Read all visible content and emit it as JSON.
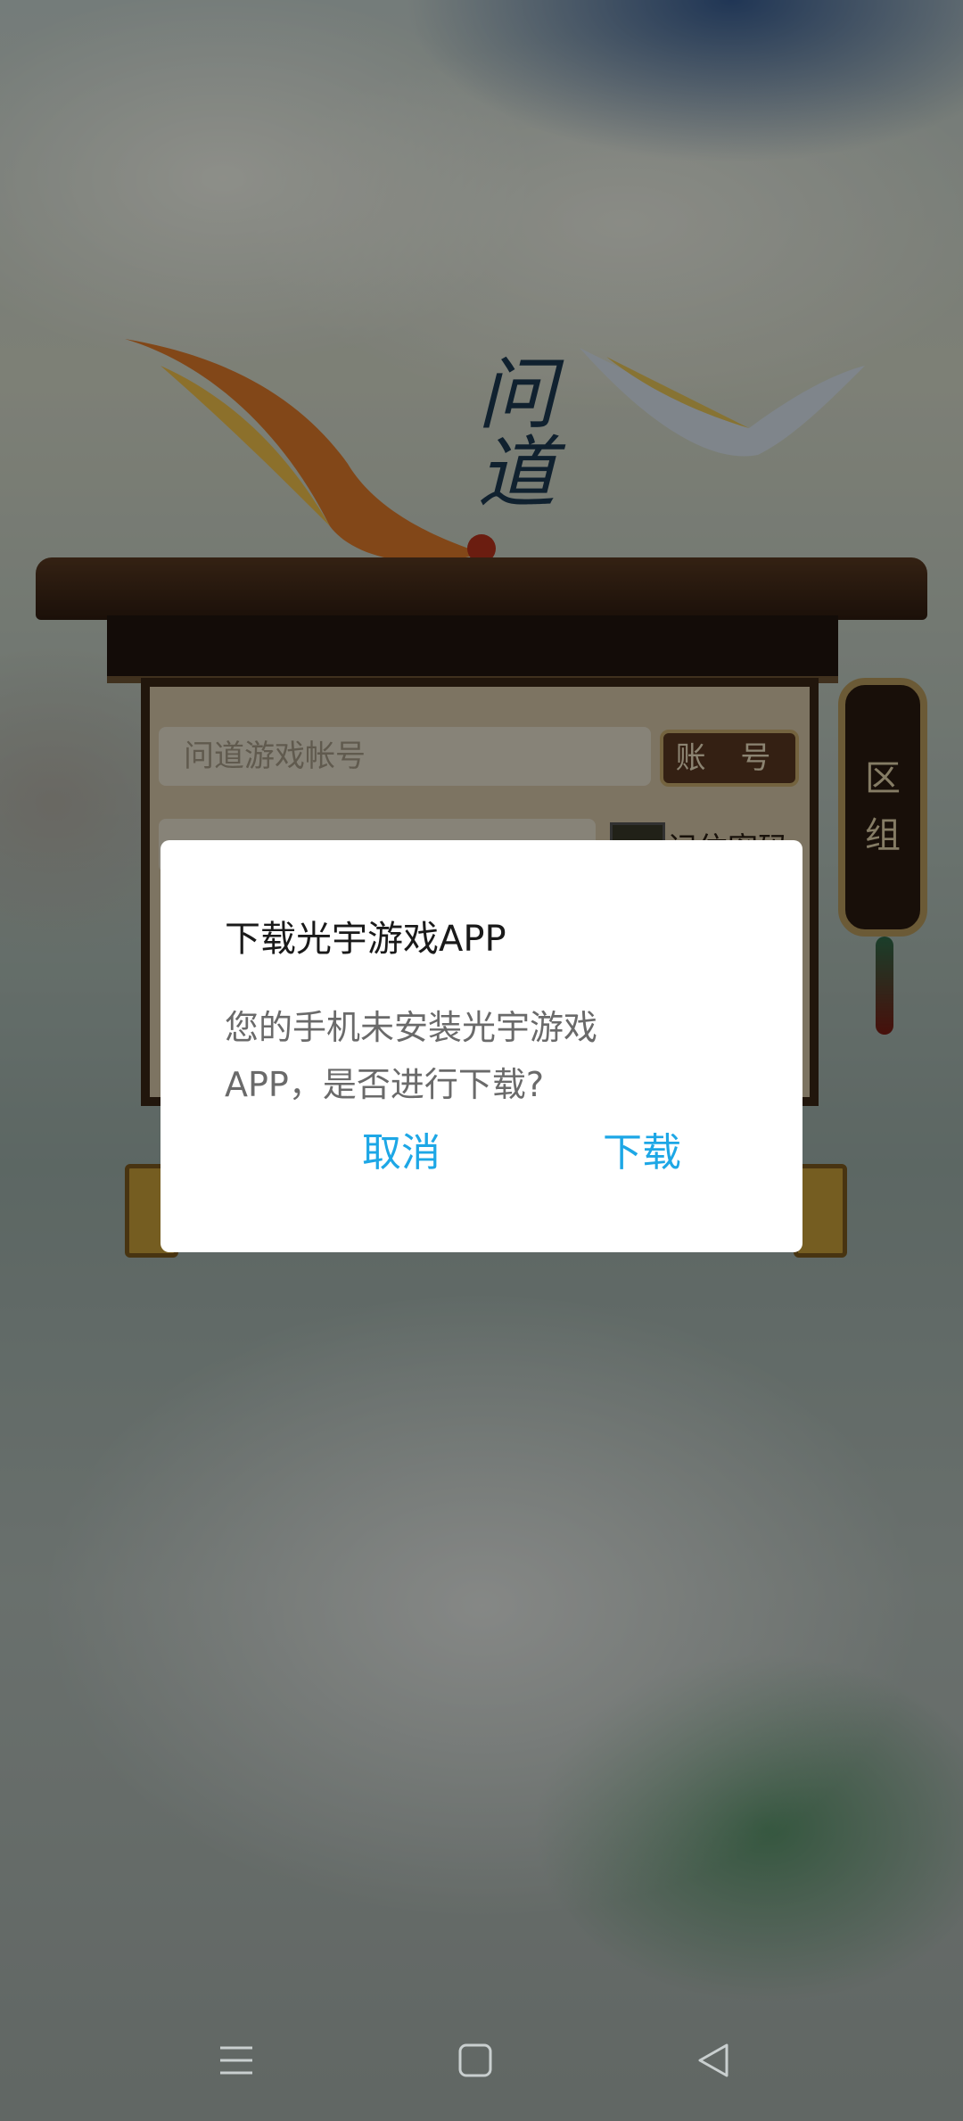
{
  "background": {
    "logo_text": "问道",
    "account_placeholder": "问道游戏帐号",
    "account_button": "账 号",
    "remember_password": "记住密码",
    "zone_label": [
      "区",
      "组"
    ]
  },
  "dialog": {
    "title": "下载光宇游戏APP",
    "message": "您的手机未安装光宇游戏APP，是否进行下载?",
    "cancel_label": "取消",
    "download_label": "下载"
  },
  "navbar": {
    "icons": [
      "menu-icon",
      "home-icon",
      "back-icon"
    ]
  },
  "colors": {
    "accent": "#1da7e6",
    "dialog_bg": "#ffffff",
    "scrim": "rgba(0,0,0,0.42)"
  }
}
